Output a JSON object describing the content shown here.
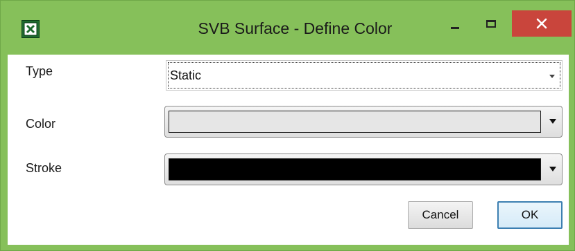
{
  "window": {
    "title": "SVB Surface - Define Color",
    "app_icon": "excel-icon",
    "accent_color": "#86c05a",
    "close_color": "#c9453c"
  },
  "form": {
    "type": {
      "label": "Type",
      "value": "Static"
    },
    "color": {
      "label": "Color",
      "value_color": "#e6e6e6"
    },
    "stroke": {
      "label": "Stroke",
      "value_color": "#000000"
    }
  },
  "buttons": {
    "cancel": "Cancel",
    "ok": "OK"
  }
}
